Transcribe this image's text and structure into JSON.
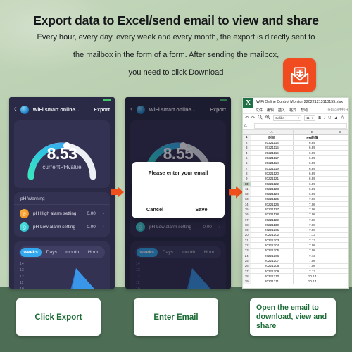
{
  "header": {
    "title": "Export data to Excel/send email to view and share",
    "line1": "Every hour, every day, every week and every month, the export is directly sent to",
    "line2": "the mailbox in the form of a form. After sending the mailbox,",
    "line3": "you need to click Download",
    "mail_icon": "envelope-download-icon",
    "accent_orange": "#f04c20"
  },
  "phone1": {
    "nav": {
      "back": "‹",
      "logo": "wifi-globe-logo",
      "title": "WiFi smart online...",
      "export": "Export"
    },
    "gauge": {
      "value": "8.53",
      "label": "currentPHvalue"
    },
    "warning": {
      "title": "pH Warning",
      "rows": [
        {
          "name": "pH High alarm setting",
          "value": "0.00",
          "chevron": "›",
          "icon": "high-alarm-icon"
        },
        {
          "name": "pH Low alarm setting",
          "value": "0.00",
          "chevron": "›",
          "icon": "low-alarm-icon"
        }
      ]
    },
    "chart": {
      "tabs": [
        "weeks",
        "Days",
        "month",
        "Hour"
      ],
      "active_tab": "weeks",
      "y_ticks": [
        "14",
        "13",
        "12",
        "11",
        "10"
      ]
    }
  },
  "phone2": {
    "nav": {
      "back": "‹",
      "logo": "wifi-globe-logo",
      "title": "WiFi smart online...",
      "export": "Export"
    },
    "gauge": {
      "value": "8.55",
      "label": "currentPHvalue"
    },
    "warning": {
      "rows": [
        {
          "name": "pH Low alarm setting",
          "value": "0.00",
          "chevron": "›",
          "icon": "low-alarm-icon"
        }
      ]
    },
    "chart": {
      "tabs": [
        "weeks",
        "Days",
        "month",
        "Hour"
      ],
      "active_tab": "weeks",
      "y_ticks": [
        "14",
        "13",
        "12",
        "11",
        "10"
      ]
    },
    "modal": {
      "title": "Please enter your email",
      "input_placeholder": "",
      "input_value": "",
      "cancel": "Cancel",
      "save": "Save"
    }
  },
  "excel": {
    "logo": "X",
    "filename": "WiFi Online Control Monitor 220221213110155.xlsx",
    "menu": [
      "文件",
      "编辑",
      "插入",
      "格式",
      "帮助"
    ],
    "menu_right": "在Excel中打开",
    "toolbar": {
      "undo": "↶",
      "redo": "↷",
      "zoom_out": "🔍",
      "zoom_in": "🔍",
      "font": "Calibri",
      "size": "11",
      "bold": "B",
      "italic": "I",
      "underline": "U",
      "fill": "▲",
      "font_color": "A"
    },
    "formula_label": "fx",
    "formula_value": "",
    "columns": [
      "A",
      "B",
      "C"
    ],
    "header_row": [
      "时间",
      "PH的值"
    ],
    "selected_row": "10",
    "rows": [
      {
        "n": "1",
        "a": "时间",
        "b": "PH的值",
        "header": true
      },
      {
        "n": "2",
        "a": "20221114",
        "b": "6.89"
      },
      {
        "n": "3",
        "a": "20221115",
        "b": "6.89"
      },
      {
        "n": "4",
        "a": "20221116",
        "b": "6.89"
      },
      {
        "n": "5",
        "a": "20221117",
        "b": "6.89"
      },
      {
        "n": "6",
        "a": "20221118",
        "b": "6.89"
      },
      {
        "n": "7",
        "a": "20221119",
        "b": "6.89"
      },
      {
        "n": "8",
        "a": "20221120",
        "b": "6.89"
      },
      {
        "n": "9",
        "a": "20221121",
        "b": "6.89"
      },
      {
        "n": "10",
        "a": "20221122",
        "b": "6.89"
      },
      {
        "n": "11",
        "a": "20221123",
        "b": "6.89"
      },
      {
        "n": "12",
        "a": "20221124",
        "b": "6.89"
      },
      {
        "n": "13",
        "a": "20221125",
        "b": "7.08"
      },
      {
        "n": "14",
        "a": "20221126",
        "b": "7.08"
      },
      {
        "n": "15",
        "a": "20221127",
        "b": "7.08"
      },
      {
        "n": "16",
        "a": "20221128",
        "b": "7.08"
      },
      {
        "n": "17",
        "a": "20221129",
        "b": "7.08"
      },
      {
        "n": "18",
        "a": "20221130",
        "b": "7.08"
      },
      {
        "n": "19",
        "a": "20221201",
        "b": "7.08"
      },
      {
        "n": "20",
        "a": "20221202",
        "b": "7.13"
      },
      {
        "n": "21",
        "a": "20221203",
        "b": "7.13"
      },
      {
        "n": "22",
        "a": "20221204",
        "b": "7.08"
      },
      {
        "n": "23",
        "a": "20221205",
        "b": "7.08"
      },
      {
        "n": "24",
        "a": "20221206",
        "b": "7.13"
      },
      {
        "n": "25",
        "a": "20221207",
        "b": "7.08"
      },
      {
        "n": "26",
        "a": "20221208",
        "b": "7.08"
      },
      {
        "n": "27",
        "a": "20221209",
        "b": "7.13"
      },
      {
        "n": "28",
        "a": "20221210",
        "b": "10.14"
      },
      {
        "n": "29",
        "a": "20221211",
        "b": "10.14"
      }
    ]
  },
  "captions": {
    "step1": "Click Export",
    "step2": "Enter Email",
    "step3": "Open the email to download, view and share",
    "text_color": "#1b6b35"
  },
  "arrows": {
    "icon": "right-arrow-icon",
    "color": "#f0511e"
  }
}
